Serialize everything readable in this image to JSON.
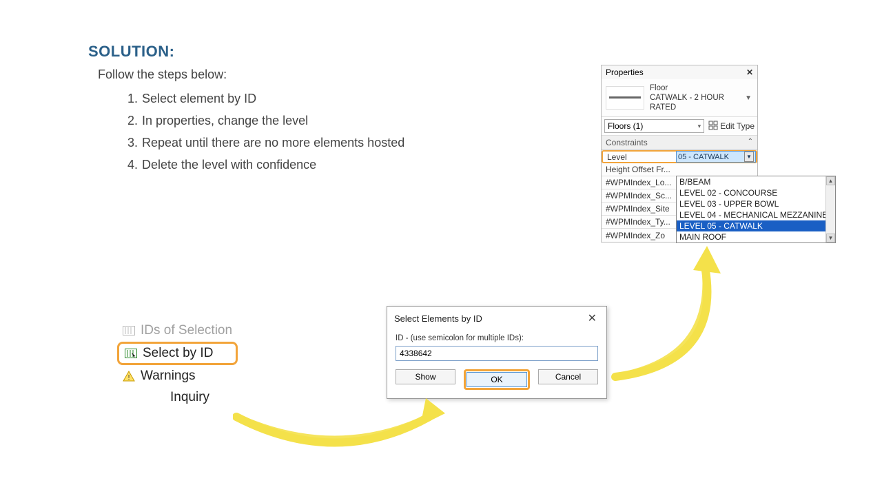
{
  "solution": {
    "title": "SOLUTION:",
    "intro": "Follow the steps below:",
    "steps": [
      "Select element by ID",
      "In properties, change the level",
      "Repeat until there are no more elements hosted",
      "Delete the level with confidence"
    ]
  },
  "inquiry_menu": {
    "ids_of_selection": "IDs of  Selection",
    "select_by_id": "Select  by ID",
    "warnings": "Warnings",
    "panel_label": "Inquiry"
  },
  "dialog": {
    "title": "Select Elements by ID",
    "label": "ID - (use semicolon for multiple IDs):",
    "value": "4338642",
    "show": "Show",
    "ok": "OK",
    "cancel": "Cancel"
  },
  "properties": {
    "title": "Properties",
    "type_category": "Floor",
    "type_name": "CATWALK - 2 HOUR RATED",
    "filter": "Floors (1)",
    "edit_type": "Edit Type",
    "constraints_header": "Constraints",
    "level_label": "Level",
    "level_value": "05 - CATWALK",
    "rows": [
      "Height Offset Fr...",
      "#WPMIndex_Lo...",
      "#WPMIndex_Sc...",
      "#WPMIndex_Site",
      "#WPMIndex_Ty...",
      "#WPMIndex_Zo"
    ],
    "level_options": [
      "B/BEAM",
      "LEVEL 02 - CONCOURSE",
      "LEVEL 03 - UPPER BOWL",
      "LEVEL 04 - MECHANICAL MEZZANINE",
      "LEVEL 05 - CATWALK",
      "MAIN ROOF"
    ],
    "selected_option": "LEVEL 05 - CATWALK"
  }
}
